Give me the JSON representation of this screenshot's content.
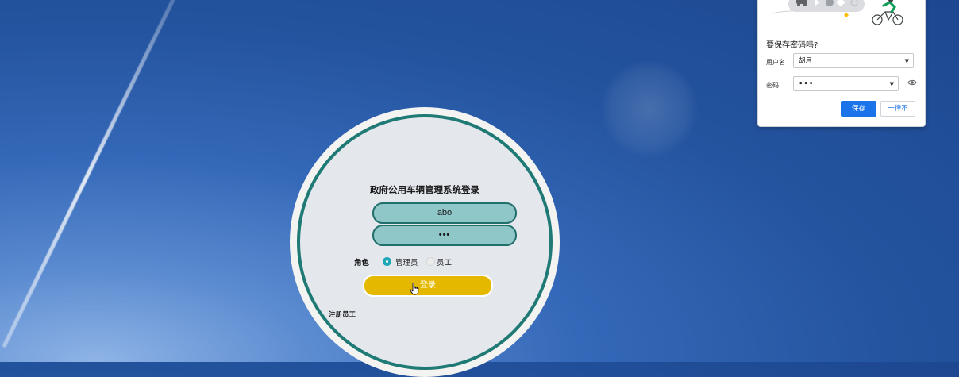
{
  "login": {
    "title": "政府公用车辆管理系统登录",
    "username_value": "abo",
    "password_value": "•••",
    "role_label": "角色",
    "role_options": [
      {
        "label": "管理员",
        "selected": true
      },
      {
        "label": "员工",
        "selected": false
      }
    ],
    "login_button": "登录",
    "register_link": "注册员工"
  },
  "password_popup": {
    "title": "要保存密码吗?",
    "username_label": "用户名",
    "username_value": "胡月",
    "password_label": "密码",
    "password_value": "•••",
    "save_button": "保存",
    "never_button": "一律不"
  },
  "colors": {
    "accent": "#1f7a76",
    "input_fill": "#8fc6c8",
    "login_button": "#e5b800",
    "popup_primary": "#1a73e8"
  }
}
